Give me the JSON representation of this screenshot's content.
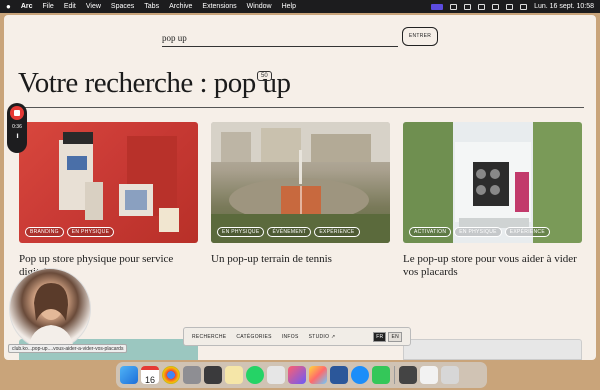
{
  "menubar": {
    "apple": "",
    "app_name": "Arc",
    "items": [
      "File",
      "Edit",
      "View",
      "Spaces",
      "Tabs",
      "Archive",
      "Extensions",
      "Window",
      "Help"
    ],
    "clock": "Lun. 16 sept.  10:58"
  },
  "search": {
    "value": "pop up",
    "enter_label": "ENTRER"
  },
  "results": {
    "heading": "Votre recherche : pop up",
    "count": "50"
  },
  "cards": [
    {
      "tags": [
        "BRANDING",
        "EN PHYSIQUE"
      ],
      "title": "Pop up store physique pour service digital"
    },
    {
      "tags": [
        "EN PHYSIQUE",
        "ÉVÉNEMENT",
        "EXPÉRIENCE"
      ],
      "title": "Un pop-up terrain de tennis"
    },
    {
      "tags": [
        "ACTIVATION",
        "EN PHYSIQUE",
        "EXPÉRIENCE"
      ],
      "title": "Le pop-up store pour vous aider à vider vos placards"
    }
  ],
  "recorder": {
    "time": "0:36",
    "pause": "II"
  },
  "bottom_nav": {
    "items": [
      "RECHERCHE",
      "CATÉGORIES",
      "INFOS",
      "STUDIO ↗"
    ],
    "lang": [
      "FR",
      "EN"
    ]
  },
  "statusbar": {
    "url": "club.ko...pop-up....vous-aider-a-vider-vos-placards"
  },
  "dock": {
    "calendar_day": "16",
    "icons": [
      "finder-icon",
      "calendar-icon",
      "chrome-icon",
      "settings-icon",
      "arc-icon",
      "notes-icon",
      "whatsapp-icon",
      "launchpad-icon",
      "creative-icon",
      "photos-icon",
      "word-icon",
      "safari-icon",
      "messages-icon",
      "app-icon",
      "preview-icon",
      "trash-icon"
    ]
  },
  "colors": {
    "brand_bg": "#f6efe8",
    "accent": "#1b1b1b",
    "record": "#e53935"
  }
}
